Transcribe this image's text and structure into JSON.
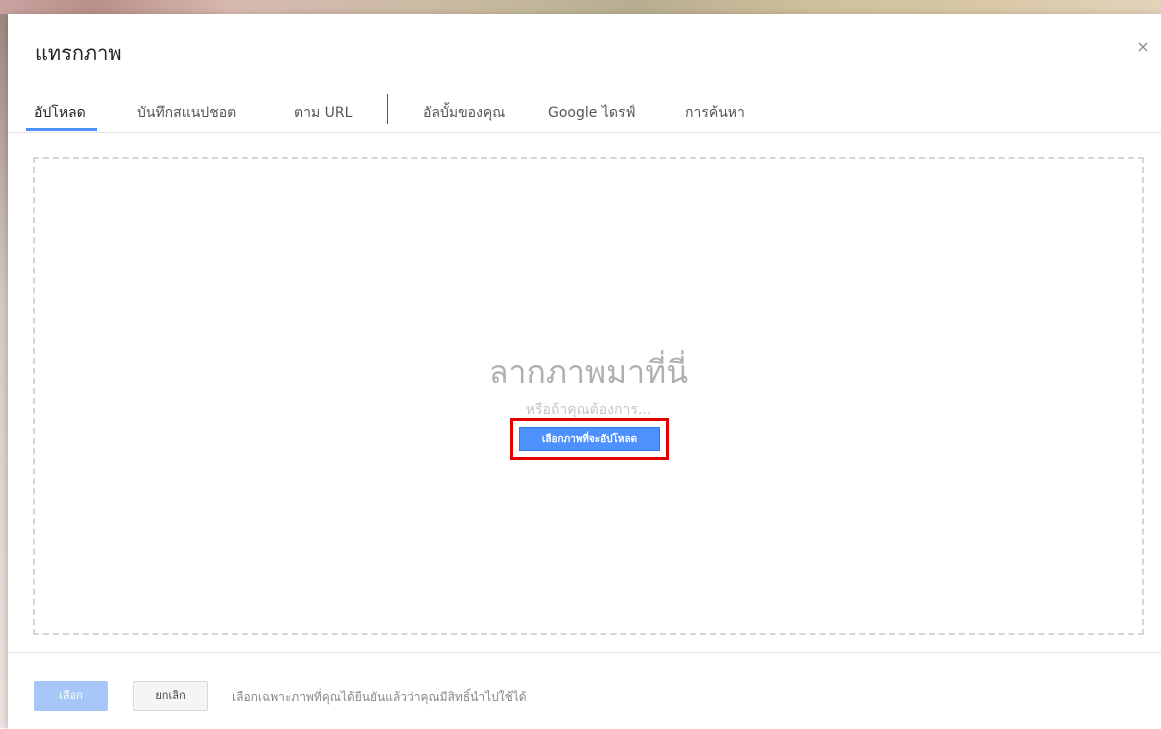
{
  "dialog": {
    "title": "แทรกภาพ",
    "close_symbol": "×"
  },
  "tabs": [
    {
      "label": "อัปโหลด",
      "active": true
    },
    {
      "label": "บันทึกสแนปชอต",
      "active": false
    },
    {
      "label": "ตาม URL",
      "active": false
    },
    {
      "label": "อัลบั้มของคุณ",
      "active": false
    },
    {
      "label": "Google ไดรฟ์",
      "active": false
    },
    {
      "label": "การค้นหา",
      "active": false
    }
  ],
  "dropzone": {
    "title": "ลากภาพมาที่นี่",
    "subtitle": "หรือถ้าคุณต้องการ...",
    "upload_button": "เลือกภาพที่จะอัปโหลด"
  },
  "footer": {
    "select_button": "เลือก",
    "cancel_button": "ยกเลิก",
    "note": "เลือกเฉพาะภาพที่คุณได้ยืนยันแล้วว่าคุณมีสิทธิ์นำไปใช้ได้"
  },
  "colors": {
    "accent": "#4d90fe",
    "highlight": "#e00000",
    "disabled_button": "#a6c7f7"
  }
}
